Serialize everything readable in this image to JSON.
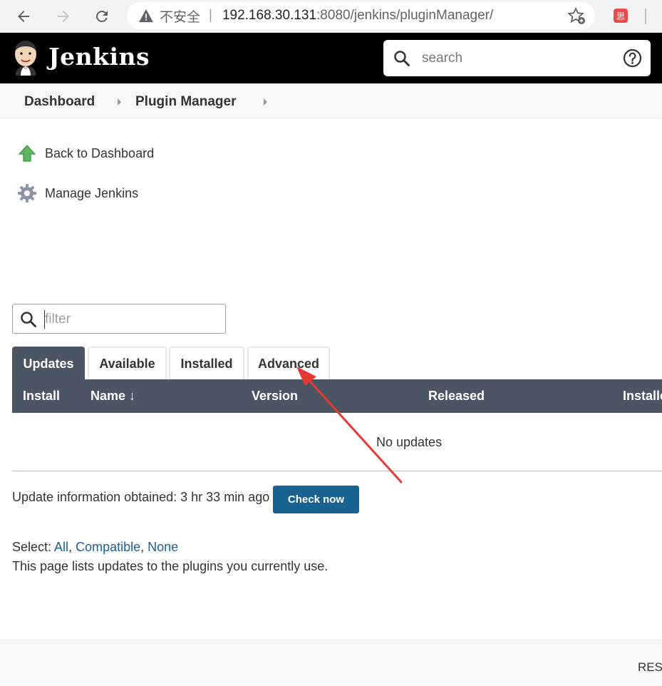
{
  "browser": {
    "insecure_label": "不安全",
    "separator": "|",
    "url_host": "192.168.30.131",
    "url_path": ":8080/jenkins/pluginManager/",
    "extension_badge": "思"
  },
  "header": {
    "brand": "Jenkins",
    "search_placeholder": "search"
  },
  "breadcrumb": {
    "items": [
      "Dashboard",
      "Plugin Manager"
    ]
  },
  "sidebar": {
    "items": [
      {
        "label": "Back to Dashboard",
        "icon": "up-arrow-icon"
      },
      {
        "label": "Manage Jenkins",
        "icon": "gear-icon"
      }
    ]
  },
  "filter": {
    "placeholder": "filter",
    "value": ""
  },
  "tabs": [
    "Updates",
    "Available",
    "Installed",
    "Advanced"
  ],
  "active_tab": "Updates",
  "table": {
    "columns": [
      "Install",
      "Name ↓",
      "Version",
      "Released",
      "Installed"
    ],
    "empty_message": "No updates"
  },
  "update_info": {
    "text": "Update information obtained: 3 hr 33 min ago",
    "check_button": "Check now"
  },
  "select": {
    "label": "Select:",
    "options": [
      "All",
      "Compatible",
      "None"
    ]
  },
  "description": "This page lists updates to the plugins you currently use.",
  "footer": {
    "rest_link": "REST API"
  },
  "colors": {
    "header_bg": "#000000",
    "tab_active_bg": "#4b5563",
    "button_bg": "#186292",
    "link": "#1a5fa0",
    "annotation_arrow": "#e53935"
  }
}
